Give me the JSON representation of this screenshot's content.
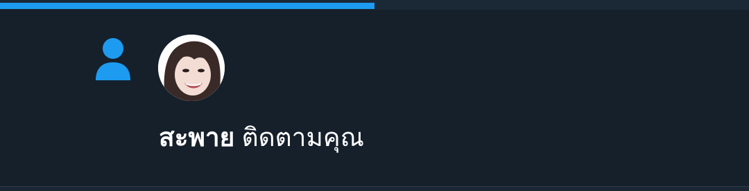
{
  "progress": {
    "fraction": 0.5,
    "color": "#1d9bf0"
  },
  "notification": {
    "type_icon": "person-icon",
    "icon_color": "#1d9bf0",
    "user_name": "สะพาย",
    "action_text": "ติดตามคุณ"
  }
}
